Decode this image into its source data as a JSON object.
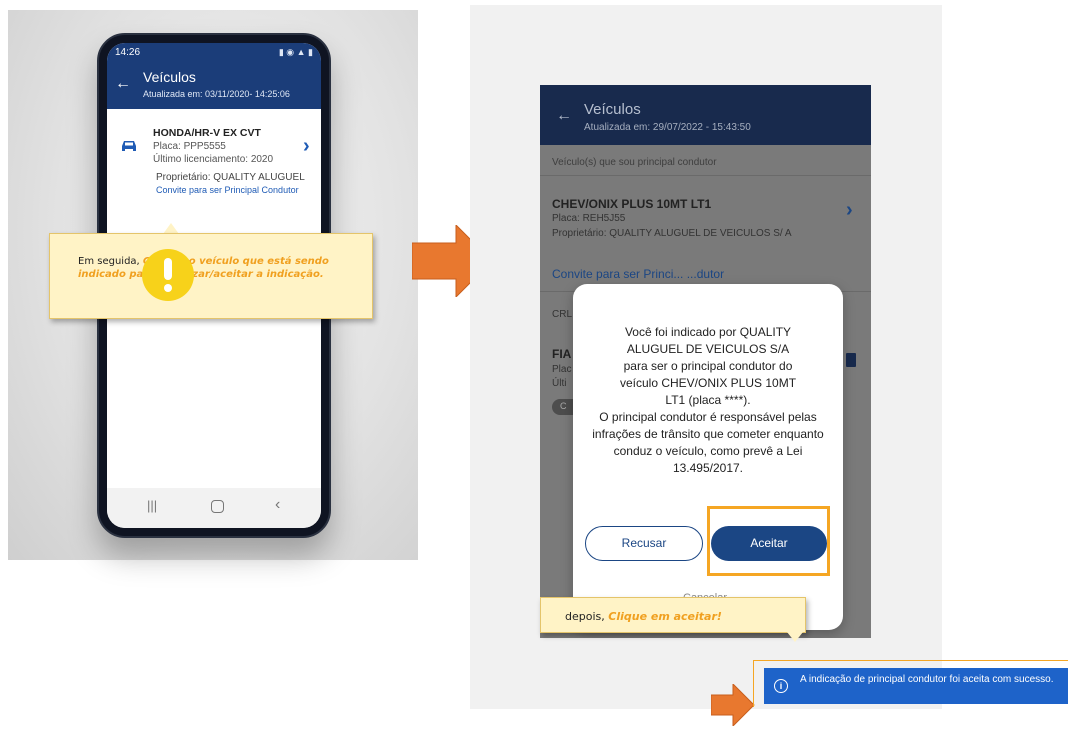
{
  "left_phone": {
    "status_time": "14:26",
    "title": "Veículos",
    "updated": "Atualizada em: 03/11/2020- 14:25:06",
    "vehicle": {
      "model": "HONDA/HR-V EX CVT",
      "plate": "Placa: PPP5555",
      "last_license": "Último licenciamento: 2020",
      "owner": "Proprietário: QUALITY ALUGUEL",
      "invite": "Convite para ser Principal Condutor"
    }
  },
  "tooltip1": {
    "prefix": "Em seguida, ",
    "highlight": "Clique no veículo que está sendo indicado para autorizar/aceitar a indicação."
  },
  "right_phone": {
    "title": "Veículos",
    "updated": "Atualizada em: 29/07/2022 - 15:43:50",
    "section": "Veículo(s) que sou principal condutor",
    "vehicle1": {
      "model": "CHEV/ONIX PLUS 10MT LT1",
      "plate": "Placa: REH5J55",
      "owner": "Proprietário: QUALITY ALUGUEL DE VEICULOS S/ A",
      "invite": "Convite para ser Princi... ...dutor"
    },
    "crl": "CRL",
    "vehicle2": {
      "model": "FIA",
      "plate": "Plac",
      "last": "Últi",
      "chip": "C"
    },
    "dialog": {
      "text1": "Você foi indicado por QUALITY ALUGUEL DE VEICULOS S/A para ser o principal condutor do veículo CHEV/ONIX PLUS 10MT LT1 (placa ****).",
      "text2": "O principal condutor é responsável pelas infrações de trânsito que cometer enquanto conduz o veículo, como prevê a Lei 13.495/2017.",
      "reject_label": "Recusar",
      "accept_label": "Aceitar",
      "cancel_label": "Cancelar"
    }
  },
  "tooltip2": {
    "prefix": "depois, ",
    "highlight": "Clique em aceitar!"
  },
  "toast": {
    "icon": "i",
    "text": "A indicação de principal condutor foi aceita com sucesso."
  },
  "colors": {
    "navy": "#1b3d79",
    "arrow_orange": "#e8782f",
    "highlight_orange": "#f5a623",
    "tooltip_bg": "#fff3c6",
    "toast_blue": "#1e63c9"
  }
}
